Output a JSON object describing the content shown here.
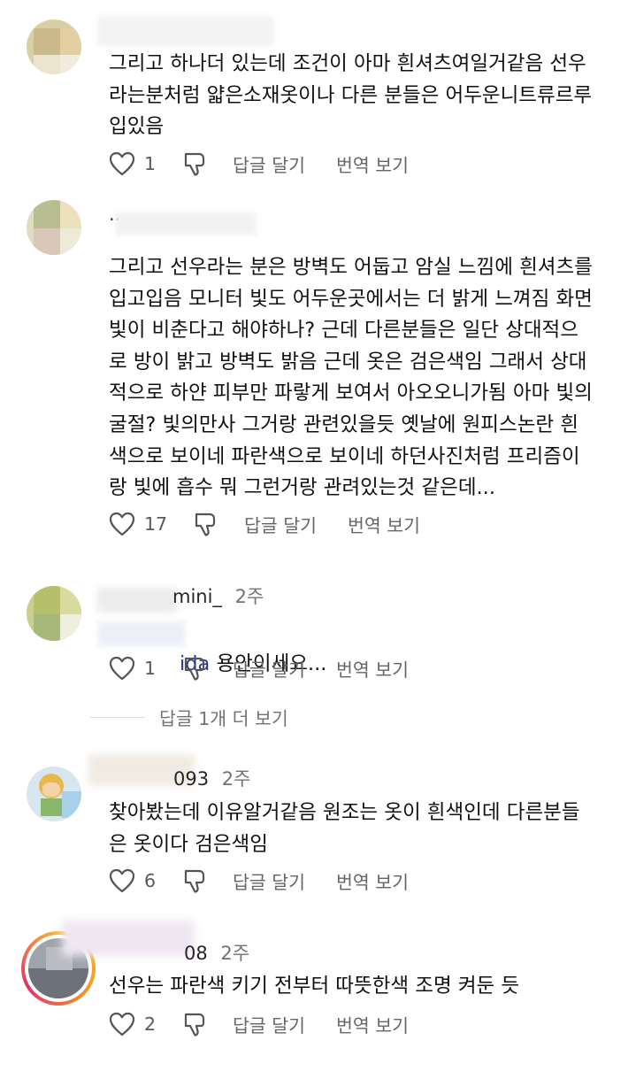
{
  "comments": [
    {
      "username": "",
      "time": "",
      "text": "그리고 하나더 있는데 조건이 아마 흰셔츠여일거같음 선우\n라는분처럼 얇은소재옷이나 다른 분들은 어두운니트류르루\n입있음",
      "likes": "1",
      "reply_label": "답글 달기",
      "translate_label": "번역 보기"
    },
    {
      "username": "..",
      "time": "",
      "text": "그리고 선우라는 분은 방벽도 어둡고 암실 느낌에 흰셔츠를\n입고입음 모니터 빛도 어두운곳에서는 더 밝게 느껴짐 화면\n빛이 비춘다고 해야하나? 근데 다른분들은 일단 상대적으\n로 방이 밝고 방벽도 밝음 근데 옷은 검은색임 그래서 상대\n적으로 하얀 피부만 파랗게 보여서 아오오니가됨 아마 빛의\n굴절? 빛의만사 그거랑 관련있을듯 옛날에 원피스논란 흰\n색으로 보이네 파란색으로 보이네 하던사진처럼 프리즘이\n랑 빛에 흡수 뭐 그런거랑 관려있는것 같은데...",
      "likes": "17",
      "reply_label": "답글 달기",
      "translate_label": "번역 보기"
    },
    {
      "username": "mini_",
      "time": "2주",
      "mention": "ida",
      "text": " 용안이세요...",
      "likes": "1",
      "reply_label": "답글 달기",
      "translate_label": "번역 보기"
    },
    {
      "username": "093",
      "time": "2주",
      "text": "찾아봤는데 이유알거같음 원조는 옷이 흰색인데 다른분들\n은 옷이다 검은색임",
      "likes": "6",
      "reply_label": "답글 달기",
      "translate_label": "번역 보기"
    },
    {
      "username": "08",
      "time": "2주",
      "text": "선우는 파란색 키기 전부터 따뜻한색 조명 켜둔 듯",
      "likes": "2",
      "reply_label": "답글 달기",
      "translate_label": "번역 보기"
    }
  ],
  "more_replies_label": "답글 1개 더 보기",
  "icons": {
    "like": "heart-icon",
    "dislike": "thumbs-down-icon"
  },
  "colors": {
    "text": "#111111",
    "meta": "#737373",
    "action": "#666666",
    "mention": "#2b3a8c",
    "story_ring": "#f0a020"
  }
}
